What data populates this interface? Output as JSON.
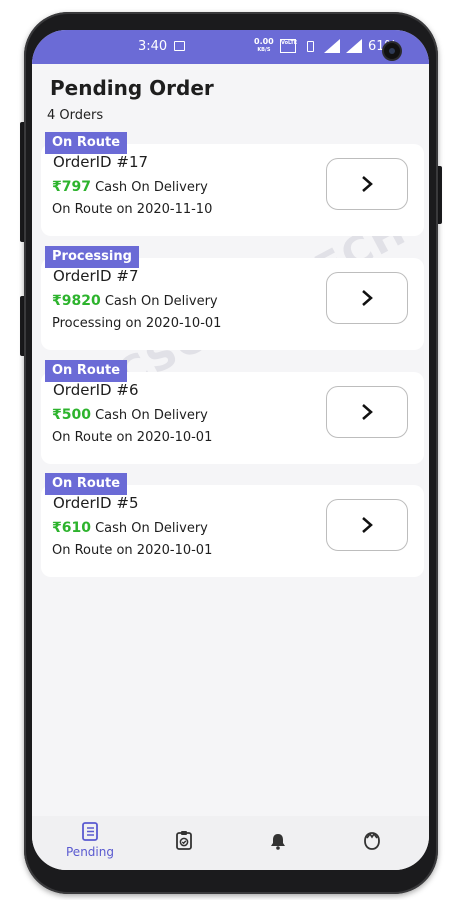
{
  "status_bar": {
    "time": "3:40",
    "data_speed": "0.00",
    "data_unit": "KB/S",
    "volte_label": "VoLTE",
    "battery": "61%"
  },
  "page": {
    "title": "Pending Order",
    "order_count": "4 Orders"
  },
  "orders": [
    {
      "status": "On Route",
      "order_id": "OrderID #17",
      "amount": "₹797",
      "payment": " Cash On Delivery",
      "status_line": "On Route on 2020-11-10"
    },
    {
      "status": "Processing",
      "order_id": "OrderID #7",
      "amount": "₹9820",
      "payment": " Cash On Delivery",
      "status_line": "Processing on 2020-10-01"
    },
    {
      "status": "On Route",
      "order_id": "OrderID #6",
      "amount": "₹500",
      "payment": " Cash On Delivery",
      "status_line": "On Route on 2020-10-01"
    },
    {
      "status": "On Route",
      "order_id": "OrderID #5",
      "amount": "₹610",
      "payment": " Cash On Delivery",
      "status_line": "On Route on 2020-10-01"
    }
  ],
  "watermark": "CSCODETECH",
  "bottom_nav": {
    "items": [
      {
        "label": "Pending",
        "icon": "receipt-icon",
        "active": true
      },
      {
        "label": "",
        "icon": "clipboard-check-icon",
        "active": false
      },
      {
        "label": "",
        "icon": "bell-icon",
        "active": false
      },
      {
        "label": "",
        "icon": "user-icon",
        "active": false
      }
    ]
  },
  "colors": {
    "accent": "#6b6bd6",
    "amount": "#2db32d",
    "background": "#f5f5f7"
  }
}
